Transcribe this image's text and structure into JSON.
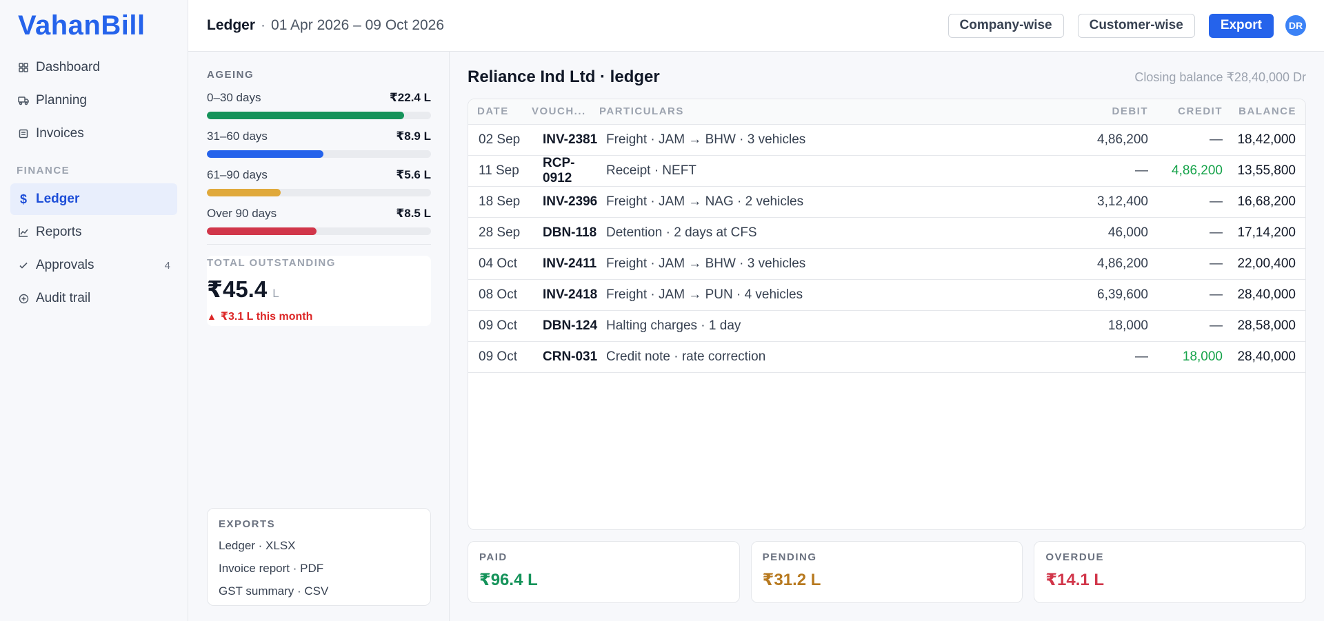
{
  "brand": {
    "name": "VahanBill"
  },
  "sidebar": {
    "items": [
      {
        "label": "Dashboard",
        "icon": "grid-icon"
      },
      {
        "label": "Planning",
        "icon": "truck-icon"
      },
      {
        "label": "Invoices",
        "icon": "invoice-icon"
      }
    ],
    "section": "FINANCE",
    "finance_items": [
      {
        "label": "Ledger",
        "icon": "dollar-icon",
        "active": true
      },
      {
        "label": "Reports",
        "icon": "chart-icon"
      },
      {
        "label": "Approvals",
        "icon": "check-icon",
        "badge": "4"
      },
      {
        "label": "Audit trail",
        "icon": "plus-circle-icon"
      }
    ]
  },
  "header": {
    "title": "Ledger",
    "separator": "·",
    "range": "01 Apr 2026 – 09 Oct 2026",
    "buttons": {
      "company": "Company-wise",
      "customer": "Customer-wise",
      "export": "Export"
    },
    "avatar": "DR"
  },
  "ageing": {
    "caption": "AGEING",
    "rows": [
      {
        "label": "0–30 days",
        "value": "₹22.4 L",
        "fraction": 0.88,
        "color": "#15935a"
      },
      {
        "label": "31–60 days",
        "value": "₹8.9 L",
        "fraction": 0.52,
        "color": "#2563eb"
      },
      {
        "label": "61–90 days",
        "value": "₹5.6 L",
        "fraction": 0.33,
        "color": "#e0a93b"
      },
      {
        "label": "Over 90 days",
        "value": "₹8.5 L",
        "fraction": 0.49,
        "color": "#d1364a"
      }
    ]
  },
  "outstanding": {
    "caption": "TOTAL OUTSTANDING",
    "amount": "₹45.4",
    "unit": "L",
    "delta_icon": "▲",
    "delta": "₹3.1 L this month"
  },
  "exports": {
    "caption": "EXPORTS",
    "links": [
      "Ledger · XLSX",
      "Invoice report · PDF",
      "GST summary · CSV"
    ]
  },
  "ledger": {
    "title": "Reliance Ind Ltd · ledger",
    "closing": "Closing balance ₹28,40,000 Dr",
    "columns": [
      "DATE",
      "VOUCH...",
      "PARTICULARS",
      "DEBIT",
      "CREDIT",
      "BALANCE"
    ],
    "rows": [
      {
        "date": "02 Sep",
        "voucher": "INV-2381",
        "particulars": "Freight · JAM → BHW · 3 vehicles",
        "debit": "4,86,200",
        "credit": "—",
        "balance": "18,42,000"
      },
      {
        "date": "11 Sep",
        "voucher": "RCP-0912",
        "particulars": "Receipt · NEFT",
        "debit": "—",
        "credit": "4,86,200",
        "balance": "13,55,800"
      },
      {
        "date": "18 Sep",
        "voucher": "INV-2396",
        "particulars": "Freight · JAM → NAG · 2 vehicles",
        "debit": "3,12,400",
        "credit": "—",
        "balance": "16,68,200"
      },
      {
        "date": "28 Sep",
        "voucher": "DBN-118",
        "particulars": "Detention · 2 days at CFS",
        "debit": "46,000",
        "credit": "—",
        "balance": "17,14,200"
      },
      {
        "date": "04 Oct",
        "voucher": "INV-2411",
        "particulars": "Freight · JAM → BHW · 3 vehicles",
        "debit": "4,86,200",
        "credit": "—",
        "balance": "22,00,400"
      },
      {
        "date": "08 Oct",
        "voucher": "INV-2418",
        "particulars": "Freight · JAM → PUN · 4 vehicles",
        "debit": "6,39,600",
        "credit": "—",
        "balance": "28,40,000"
      },
      {
        "date": "09 Oct",
        "voucher": "DBN-124",
        "particulars": "Halting charges · 1 day",
        "debit": "18,000",
        "credit": "—",
        "balance": "28,58,000"
      },
      {
        "date": "09 Oct",
        "voucher": "CRN-031",
        "particulars": "Credit note · rate correction",
        "debit": "—",
        "credit": "18,000",
        "balance": "28,40,000"
      }
    ]
  },
  "stats": [
    {
      "caption": "PAID",
      "value": "₹96.4 L",
      "color": "#15935a"
    },
    {
      "caption": "PENDING",
      "value": "₹31.2 L",
      "color": "#b7791f"
    },
    {
      "caption": "OVERDUE",
      "value": "₹14.1 L",
      "color": "#d1364a"
    }
  ]
}
